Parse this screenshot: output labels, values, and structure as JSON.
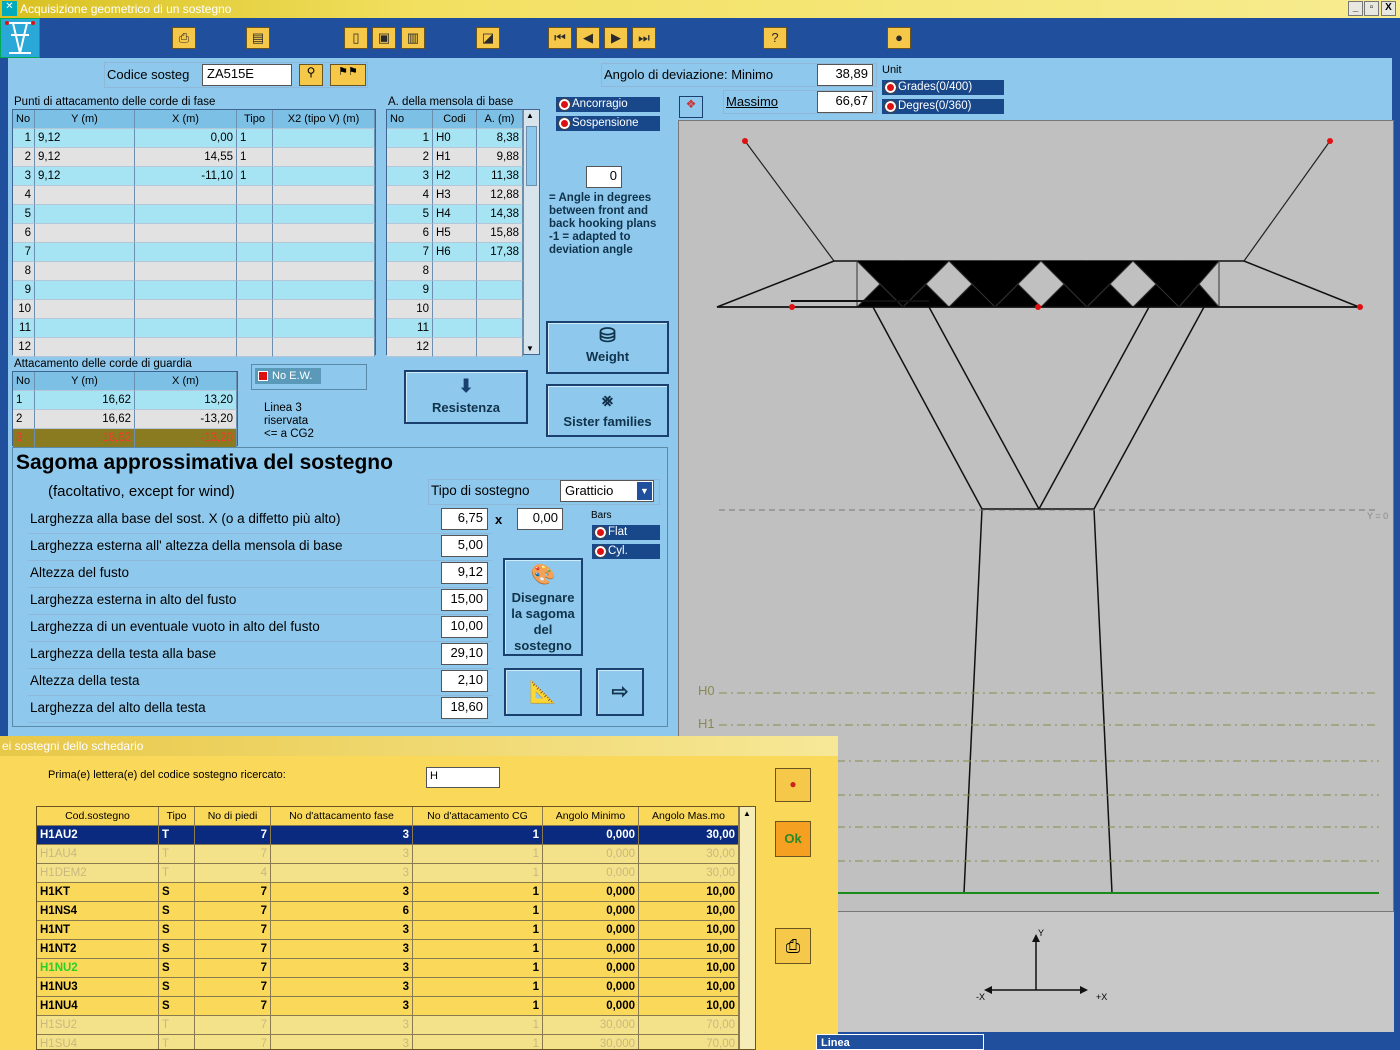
{
  "window": {
    "title": "Acquisizione geometrico di un sostegno",
    "min": "_",
    "max": "▫",
    "close": "X"
  },
  "toolbar": {
    "items": [
      {
        "icon": "printer-icon",
        "glyph": "⎙"
      },
      {
        "icon": "print-preview-icon",
        "glyph": "▤"
      },
      {
        "icon": "new-doc-icon",
        "glyph": "▯"
      },
      {
        "icon": "save-icon",
        "glyph": "▣"
      },
      {
        "icon": "delete-icon",
        "glyph": "▥"
      },
      {
        "icon": "eraser-icon",
        "glyph": "◪"
      },
      {
        "icon": "first-record-icon",
        "glyph": "⏮"
      },
      {
        "icon": "prev-record-icon",
        "glyph": "◀"
      },
      {
        "icon": "next-record-icon",
        "glyph": "▶"
      },
      {
        "icon": "last-record-icon",
        "glyph": "⏭"
      },
      {
        "icon": "help-icon",
        "glyph": "?"
      },
      {
        "icon": "exit-icon",
        "glyph": "●"
      }
    ]
  },
  "codice": {
    "label": "Codice sosteg",
    "value": "ZA515E"
  },
  "angolo": {
    "label": "Angolo di deviazione: Minimo",
    "min": "38,89",
    "max_label": "Massimo",
    "max": "66,67",
    "unit_label": "Unit",
    "units": [
      "Grades(0/400)",
      "Degres(0/360)"
    ]
  },
  "fase": {
    "title": "Punti di attacamento delle corde di fase",
    "headers": [
      "No",
      "Y (m)",
      "X (m)",
      "Tipo",
      "X2 (tipo V) (m)"
    ],
    "rows": [
      [
        "1",
        "9,12",
        "0,00",
        "1",
        ""
      ],
      [
        "2",
        "9,12",
        "14,55",
        "1",
        ""
      ],
      [
        "3",
        "9,12",
        "-11,10",
        "1",
        ""
      ],
      [
        "4",
        "",
        "",
        "",
        ""
      ],
      [
        "5",
        "",
        "",
        "",
        ""
      ],
      [
        "6",
        "",
        "",
        "",
        ""
      ],
      [
        "7",
        "",
        "",
        "",
        ""
      ],
      [
        "8",
        "",
        "",
        "",
        ""
      ],
      [
        "9",
        "",
        "",
        "",
        ""
      ],
      [
        "10",
        "",
        "",
        "",
        ""
      ],
      [
        "11",
        "",
        "",
        "",
        ""
      ],
      [
        "12",
        "",
        "",
        "",
        ""
      ]
    ]
  },
  "mensola": {
    "title": "A. della mensola di base",
    "headers": [
      "No",
      "Codi",
      "A. (m)"
    ],
    "rows": [
      [
        "1",
        "H0",
        "8,38"
      ],
      [
        "2",
        "H1",
        "9,88"
      ],
      [
        "3",
        "H2",
        "11,38"
      ],
      [
        "4",
        "H3",
        "12,88"
      ],
      [
        "5",
        "H4",
        "14,38"
      ],
      [
        "6",
        "H5",
        "15,88"
      ],
      [
        "7",
        "H6",
        "17,38"
      ],
      [
        "8",
        "",
        ""
      ],
      [
        "9",
        "",
        ""
      ],
      [
        "10",
        "",
        ""
      ],
      [
        "11",
        "",
        ""
      ],
      [
        "12",
        "",
        ""
      ]
    ]
  },
  "hooking": {
    "options": [
      "Ancorragio",
      "Sospensione"
    ],
    "angle": "0",
    "note": "= Angle in degrees between front and back hooking plans -1 = adapted to deviation angle"
  },
  "guardia": {
    "title": "Attacamento delle corde di guardia",
    "headers": [
      "No",
      "Y (m)",
      "X (m)"
    ],
    "rows": [
      [
        "1",
        "16,62",
        "13,20"
      ],
      [
        "2",
        "16,62",
        "-13,20"
      ],
      [
        "3",
        "16,62",
        "-13,20"
      ]
    ],
    "no_ew": "No E.W.",
    "linea_note": "Linea 3 riservata <= a CG2"
  },
  "buttons": {
    "resistenza": "Resistenza",
    "weight": "Weight",
    "sister": "Sister families",
    "disegnare": "Disegnare la sagoma del sostegno"
  },
  "sagoma": {
    "title": "Sagoma approssimativa del sostegno",
    "subtitle": "(facoltativo, except for wind)",
    "tipo_label": "Tipo di sostegno",
    "tipo_value": "Gratticio",
    "bars_label": "Bars",
    "bars": [
      "Flat",
      "Cyl."
    ],
    "fields": [
      {
        "label": "Larghezza alla base del sost. X (o a diffetto più alto)",
        "value": "6,75"
      },
      {
        "label": "Larghezza esterna all' altezza della mensola di base",
        "value": "5,00"
      },
      {
        "label": "Altezza del fusto",
        "value": "9,12"
      },
      {
        "label": "Larghezza esterna in alto del fusto",
        "value": "15,00"
      },
      {
        "label": "Larghezza di un eventuale vuoto in alto del fusto",
        "value": "10,00"
      },
      {
        "label": "Larghezza della testa alla base",
        "value": "29,10"
      },
      {
        "label": "Altezza della testa",
        "value": "2,10"
      },
      {
        "label": "Larghezza del alto della testa",
        "value": "18,60"
      }
    ],
    "x_sep": "x",
    "x2": "0,00"
  },
  "drawing": {
    "y0": "Y = 0",
    "h0": "H0",
    "h1": "H1",
    "axis_y": "Y",
    "axis_mx": "-X",
    "axis_px": "+X"
  },
  "dialog": {
    "title": "ei sostegni dello schedario",
    "search_label": "Prima(e) lettera(e) del codice sostegno ricercato:",
    "search_value": "H",
    "ok": "Ok",
    "headers": [
      "Cod.sostegno",
      "Tipo",
      "No di piedi",
      "No d'attacamento fase",
      "No d'attacamento CG",
      "Angolo Minimo",
      "Angolo Mas.mo"
    ],
    "rows": [
      [
        "H1AU2",
        "T",
        "7",
        "3",
        "1",
        "0,000",
        "30,00"
      ],
      [
        "H1AU4",
        "T",
        "7",
        "3",
        "1",
        "0,000",
        "30,00"
      ],
      [
        "H1DEM2",
        "T",
        "4",
        "3",
        "1",
        "0,000",
        "30,00"
      ],
      [
        "H1KT",
        "S",
        "7",
        "3",
        "1",
        "0,000",
        "10,00"
      ],
      [
        "H1NS4",
        "S",
        "7",
        "6",
        "1",
        "0,000",
        "10,00"
      ],
      [
        "H1NT",
        "S",
        "7",
        "3",
        "1",
        "0,000",
        "10,00"
      ],
      [
        "H1NT2",
        "S",
        "7",
        "3",
        "1",
        "0,000",
        "10,00"
      ],
      [
        "H1NU2",
        "S",
        "7",
        "3",
        "1",
        "0,000",
        "10,00"
      ],
      [
        "H1NU3",
        "S",
        "7",
        "3",
        "1",
        "0,000",
        "10,00"
      ],
      [
        "H1NU4",
        "S",
        "7",
        "3",
        "1",
        "0,000",
        "10,00"
      ],
      [
        "H1SU2",
        "T",
        "7",
        "3",
        "1",
        "30,000",
        "70,00"
      ],
      [
        "H1SU4",
        "T",
        "7",
        "3",
        "1",
        "30,000",
        "70,00"
      ]
    ]
  },
  "taskbar": {
    "linea": "Linea"
  }
}
